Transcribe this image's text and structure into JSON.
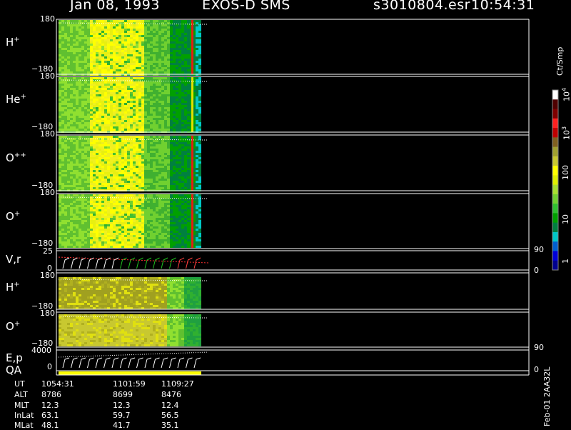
{
  "header": {
    "date": "Jan 08, 1993",
    "instrument": "EXOS-D SMS",
    "file": "s3010804.esr",
    "time": "10:54:31"
  },
  "panels": [
    {
      "id": "h-spin",
      "name": "H",
      "charge": "+",
      "ymax": "180",
      "ymin": "−180"
    },
    {
      "id": "he-spin",
      "name": "He",
      "charge": "+",
      "ymax": "180",
      "ymin": "−180"
    },
    {
      "id": "opp-spin",
      "name": "O",
      "charge": "++",
      "ymax": "180",
      "ymin": "−180"
    },
    {
      "id": "o-spin",
      "name": "O",
      "charge": "+",
      "ymax": "180",
      "ymin": "−180"
    },
    {
      "id": "vr",
      "name": "V,r",
      "charge": "",
      "ymax": "25",
      "ymin": "0",
      "rtop": "90",
      "rbot": "0"
    },
    {
      "id": "h-pitch",
      "name": "H",
      "charge": "+",
      "ymax": "180",
      "ymin": "−180"
    },
    {
      "id": "o-pitch",
      "name": "O",
      "charge": "+",
      "ymax": "180",
      "ymin": "−180"
    },
    {
      "id": "ep",
      "name": "E,p",
      "charge": "",
      "ymax": "4000",
      "ymin": "0",
      "rtop": "90",
      "rbot": "0"
    },
    {
      "id": "qa",
      "name": "QA",
      "charge": ""
    }
  ],
  "colorbar": {
    "unit": "Ct/Smp",
    "labels": [
      "1",
      "10",
      "100",
      "10",
      "10"
    ],
    "exponents": [
      "",
      "",
      "",
      "3",
      "4"
    ],
    "colors": [
      "#000090",
      "#0000d8",
      "#0060d0",
      "#00c8c8",
      "#008040",
      "#00a000",
      "#30c030",
      "#70d030",
      "#a8e030",
      "#e0f000",
      "#ffff00",
      "#c8c830",
      "#a0a030",
      "#806020",
      "#c00000",
      "#ff2020",
      "#800000",
      "#500000",
      "#ffffff"
    ]
  },
  "ephemeris": {
    "rows": [
      {
        "label": "UT",
        "values": [
          "1054:31",
          "1101:59",
          "1109:27"
        ]
      },
      {
        "label": "ALT",
        "values": [
          "8786",
          "8699",
          "8476"
        ]
      },
      {
        "label": "MLT",
        "values": [
          "12.3",
          "12.3",
          "12.4"
        ]
      },
      {
        "label": "InLat",
        "values": [
          "63.1",
          "59.7",
          "56.5"
        ]
      },
      {
        "label": "MLat",
        "values": [
          "48.1",
          "41.7",
          "35.1"
        ]
      }
    ]
  },
  "side_id": "Feb-01 2AA32L",
  "chart_data": {
    "type": "heatmap",
    "title": "Jan 08, 1993 EXOS-D SMS",
    "x_ticks_ut": [
      "1054:31",
      "1101:59",
      "1109:27"
    ],
    "series": [
      {
        "name": "H+",
        "ylim": [
          -180,
          180
        ],
        "dominant": "yellow-green",
        "red_band": true
      },
      {
        "name": "He+",
        "ylim": [
          -180,
          180
        ],
        "dominant": "yellow-green"
      },
      {
        "name": "O++",
        "ylim": [
          -180,
          180
        ],
        "dominant": "yellow-green"
      },
      {
        "name": "O+",
        "ylim": [
          -180,
          180
        ],
        "dominant": "yellow-green"
      },
      {
        "name": "V,r",
        "ylim": [
          0,
          25
        ]
      },
      {
        "name": "H+",
        "ylim": [
          -180,
          180
        ],
        "dominant": "olive-yellow"
      },
      {
        "name": "O+",
        "ylim": [
          -180,
          180
        ],
        "dominant": "olive-yellow"
      },
      {
        "name": "E,p",
        "ylim": [
          0,
          4000
        ]
      }
    ],
    "colorscale": {
      "min": 1,
      "max": 10000,
      "scale": "log"
    }
  }
}
